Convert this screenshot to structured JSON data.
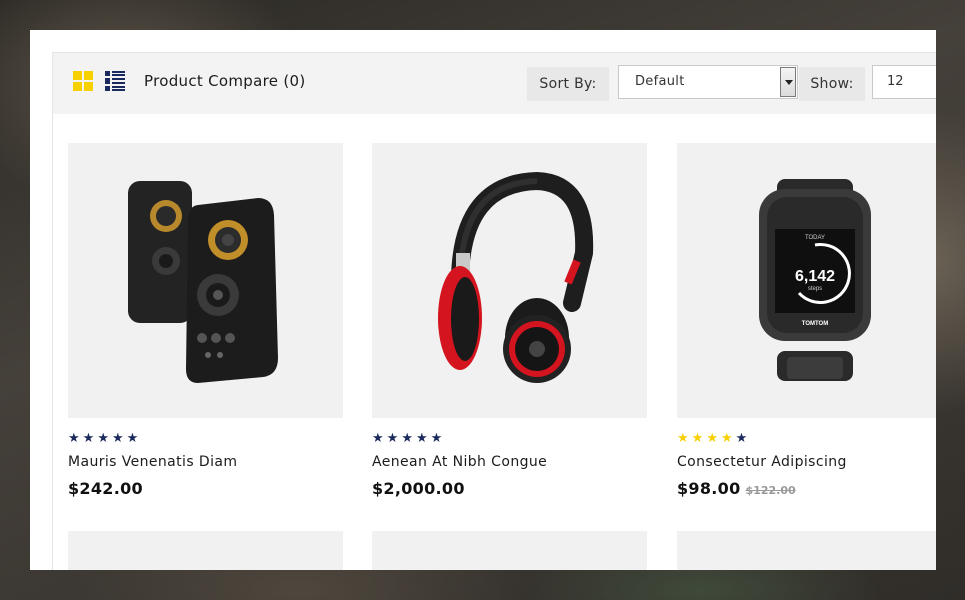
{
  "toolbar": {
    "compare_label": "Product Compare (0)",
    "sort_label": "Sort By:",
    "sort_value": "Default",
    "show_label": "Show:",
    "show_value": "12"
  },
  "colors": {
    "accent_yellow": "#f7d000",
    "star_blue": "#1b2a5c",
    "star_yellow": "#f7d000"
  },
  "products": [
    {
      "name": "Mauris Venenatis Diam",
      "price": "$242.00",
      "old_price": "",
      "rating": 5,
      "star_color": "blue",
      "image": "speakers-image"
    },
    {
      "name": "Aenean At Nibh Congue",
      "price": "$2,000.00",
      "old_price": "",
      "rating": 5,
      "star_color": "blue",
      "image": "headphones-image"
    },
    {
      "name": "Consectetur Adipiscing",
      "price": "$98.00",
      "old_price": "$122.00",
      "rating": 5,
      "star_color": "mixed",
      "image": "smartwatch-image"
    }
  ],
  "watch_screen": {
    "label_top": "TODAY",
    "steps": "6,142",
    "steps_unit": "steps",
    "brand": "TOMTOM"
  }
}
